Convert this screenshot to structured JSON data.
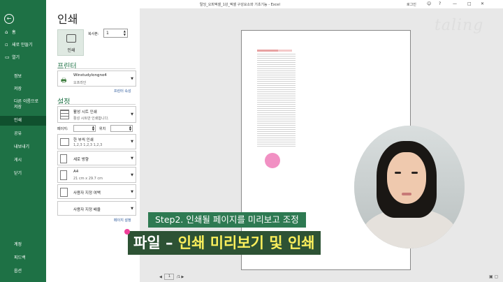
{
  "titlebar": {
    "title": "탈잉_오피엑셀_1강_엑셀 구성요소와 기초기능 - Excel",
    "login": "로그인",
    "minimize": "—",
    "restore": "□",
    "close": "✕"
  },
  "sidebar": {
    "back": "←",
    "items": [
      {
        "label": "홈"
      },
      {
        "label": "새로 만들기"
      },
      {
        "label": "열기"
      },
      {
        "label": "정보"
      },
      {
        "label": "저장"
      },
      {
        "label": "다른 이름으로"
      },
      {
        "label": "저장"
      },
      {
        "label": "인쇄"
      },
      {
        "label": "공유"
      },
      {
        "label": "내보내기"
      },
      {
        "label": "게시"
      },
      {
        "label": "닫기"
      },
      {
        "label": "계정"
      },
      {
        "label": "피드백"
      },
      {
        "label": "옵션"
      }
    ]
  },
  "print": {
    "title": "인쇄",
    "button_label": "인쇄",
    "copies_label": "복사본:",
    "copies_value": "1"
  },
  "printer": {
    "heading": "프린터",
    "name": "Winstudylongno4",
    "status": "오프라인",
    "properties_link": "프린터 속성"
  },
  "settings": {
    "heading": "설정",
    "scope_title": "활성 시트 인쇄",
    "scope_sub": "활성 시트만 인쇄합니다.",
    "pages_label": "페이지:",
    "to_label": "위치",
    "collate_title": "한 부씩 인쇄",
    "collate_sub": "1,2,3    1,2,3    1,2,3",
    "orientation": "세로 방향",
    "paper_title": "A4",
    "paper_sub": "21 cm x 29.7 cm",
    "margins": "사용자 지정 여백",
    "scaling": "사용자 지정 배율",
    "page_setup_link": "페이지 설정"
  },
  "preview": {
    "page_value": "1",
    "page_total": "/1",
    "prev": "◀",
    "next": "▶",
    "view_icons": "▣ ▢"
  },
  "overlay": {
    "brand": "taling",
    "caption1": "Step2. 인쇄될 페이지를 미리보고 조정",
    "caption2_a": "파일 – ",
    "caption2_b": "인쇄 미리보기 및 인쇄"
  }
}
